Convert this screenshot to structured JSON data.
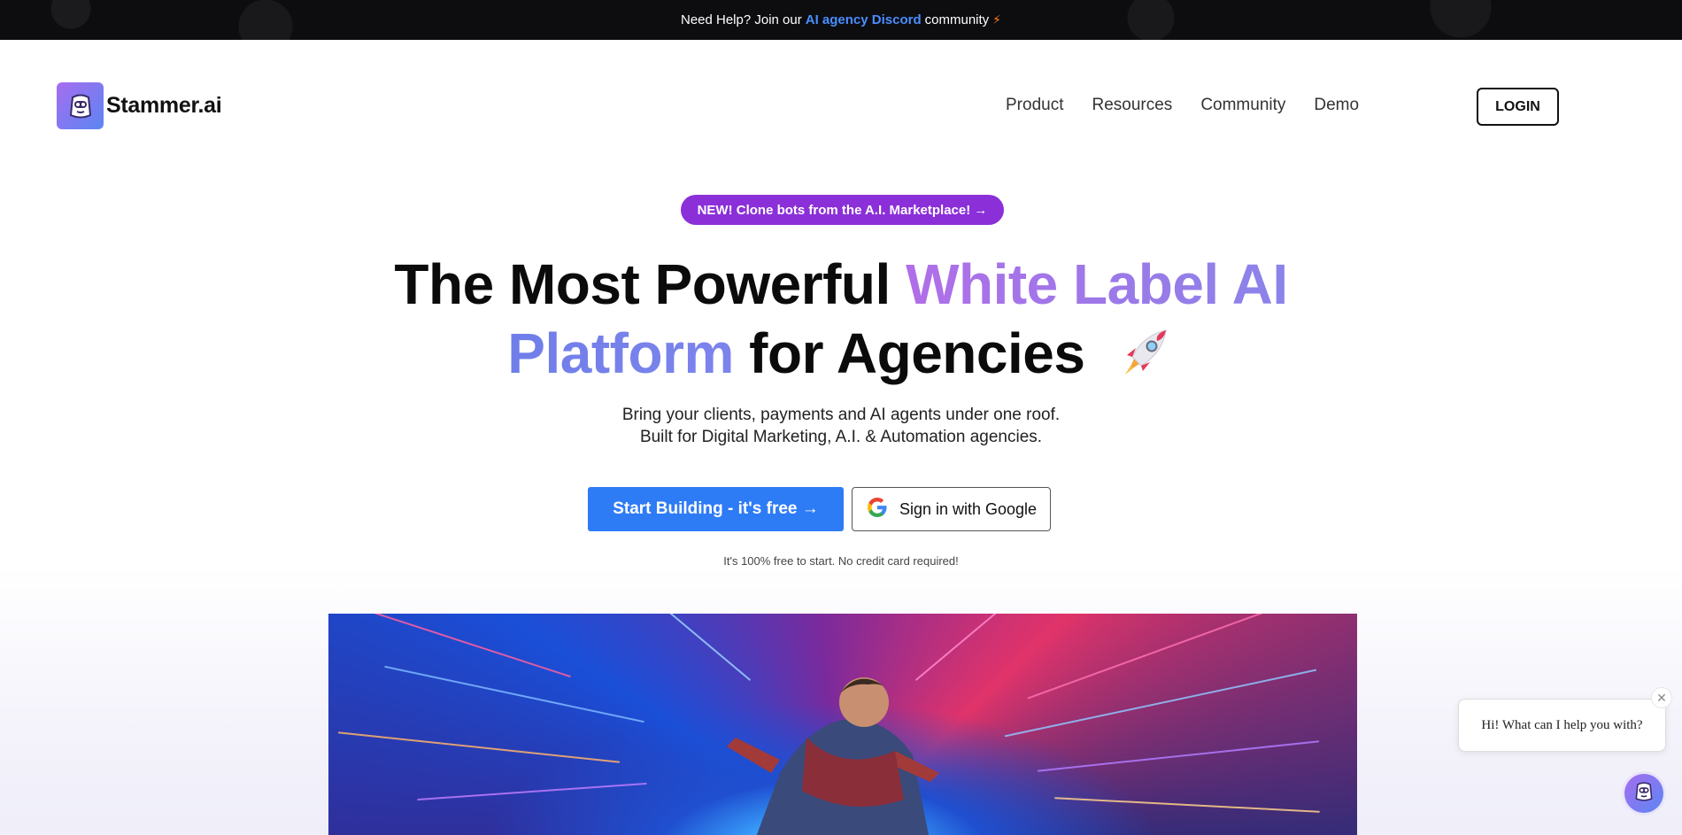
{
  "announcement": {
    "prefix": "Need Help? Join our",
    "link": "AI agency Discord",
    "suffix": "community",
    "icon": "lightning-icon"
  },
  "header": {
    "brand": "Stammer.ai",
    "logo_icon": "robot-logo-icon",
    "nav": [
      "Product",
      "Resources",
      "Community",
      "Demo"
    ],
    "login_label": "LOGIN"
  },
  "hero": {
    "badge": "NEW! Clone bots from the A.I. Marketplace! →",
    "headline": {
      "part1": "The Most Powerful ",
      "highlight1": "White Label AI",
      "highlight2": "Platform",
      "part2": " for Agencies",
      "icon": "rocket-icon"
    },
    "subtitle_line1": "Bring your clients, payments and AI agents under one roof.",
    "subtitle_line2": "Built for Digital Marketing, A.I. & Automation agencies.",
    "primary_cta": "Start Building - it's free →",
    "google_cta": "Sign in with Google",
    "note": "It's 100% free to start. No credit card required!"
  },
  "chat_widget": {
    "greeting": "Hi! What can I help you with?",
    "close_icon": "close-icon",
    "launcher_icon": "robot-chat-icon"
  },
  "colors": {
    "accent_blue": "#2e7bf6",
    "badge_purple": "#8b2fd9",
    "headline_purple": "#b06ee8",
    "headline_blue": "#6f7ee9",
    "link_blue": "#4a8dff"
  }
}
